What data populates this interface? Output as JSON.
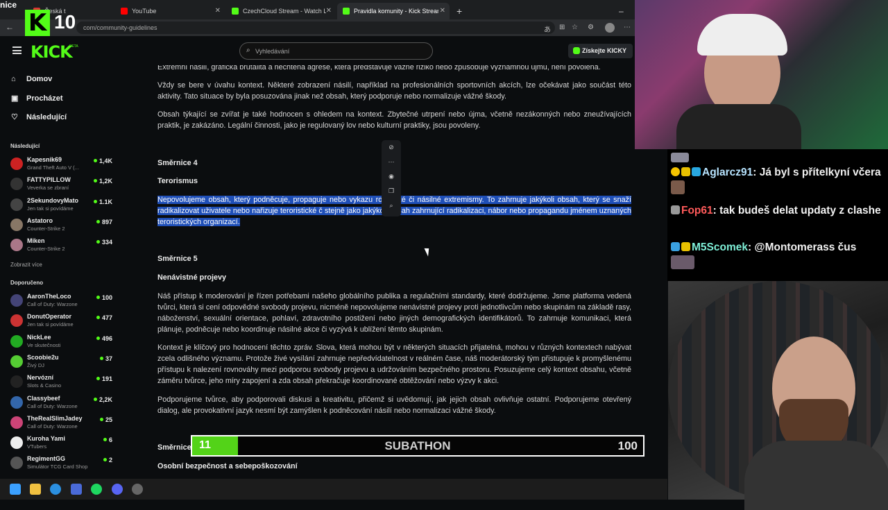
{
  "browser": {
    "tabs": [
      {
        "label": "Česká t",
        "color": "#d33"
      },
      {
        "label": "YouTube",
        "color": "#f00"
      },
      {
        "label": "CzechCloud Stream - Watch Live o",
        "color": "#53fc18"
      },
      {
        "label": "Pravidla komunity - Kick Streamin",
        "color": "#53fc18"
      }
    ],
    "url": "com/community-guidelines",
    "overlay_text": "nice"
  },
  "kick": {
    "logo": "KICK",
    "beta": "BETA",
    "search_placeholder": "Vyhledávání",
    "get_kicky": "Získejte KICKY",
    "counter": "10"
  },
  "sidebar": {
    "nav": [
      {
        "label": "Domov",
        "icon": "home-icon"
      },
      {
        "label": "Procházet",
        "icon": "browse-icon"
      },
      {
        "label": "Následující",
        "icon": "heart-icon"
      }
    ],
    "following_title": "Následující",
    "following": [
      {
        "name": "Kapesnik69",
        "game": "Grand Theft Auto V (...",
        "viewers": "1,4K",
        "color": "#c22"
      },
      {
        "name": "FATTYPILLOW",
        "game": "Veverka se zbraní",
        "viewers": "1,2K",
        "color": "#333"
      },
      {
        "name": "2SekundovyMato",
        "game": "Jen tak si povídáme",
        "viewers": "1.1K",
        "color": "#444"
      },
      {
        "name": "Astatoro",
        "game": "Counter-Strike 2",
        "viewers": "897",
        "color": "#876"
      },
      {
        "name": "Miken",
        "game": "Counter-Strike 2",
        "viewers": "334",
        "color": "#a78"
      }
    ],
    "show_more": "Zobrazit více",
    "recommended_title": "Doporučeno",
    "recommended": [
      {
        "name": "AaronTheLoco",
        "game": "Call of Duty: Warzone",
        "viewers": "100",
        "color": "#447"
      },
      {
        "name": "DonutOperator",
        "game": "Jen tak si povídáme",
        "viewers": "477",
        "color": "#c33"
      },
      {
        "name": "NickLee",
        "game": "Ve skutečnosti",
        "viewers": "496",
        "color": "#2a2"
      },
      {
        "name": "Scoobie2u",
        "game": "Živý DJ",
        "viewers": "37",
        "color": "#5c3"
      },
      {
        "name": "Nervózní",
        "game": "Slots & Casino",
        "viewers": "191",
        "color": "#222"
      },
      {
        "name": "Classybeef",
        "game": "Call of Duty: Warzone",
        "viewers": "2,2K",
        "color": "#36a"
      },
      {
        "name": "TheRealSlimJadey",
        "game": "Call of Duty: Warzone",
        "viewers": "25",
        "color": "#c47"
      },
      {
        "name": "Kuroha Yami",
        "game": "VTubers",
        "viewers": "6",
        "color": "#eee"
      },
      {
        "name": "RegimentGG",
        "game": "Simulátor TCG Card Shop",
        "viewers": "2",
        "color": "#555"
      }
    ]
  },
  "content": {
    "p1": "Extrémní násilí, grafická brutalita a nechtěná agrese, která představuje vážné riziko nebo způsobuje významnou újmu, není povolena.",
    "p2": "Vždy se bere v úvahu kontext. Některé zobrazení násilí, například na profesionálních sportovních akcích, lze očekávat jako součást této aktivity. Tato situace by byla posuzována jinak než obsah, který podporuje nebo normalizuje vážné škody.",
    "p3": "Obsah týkající se zvířat je také hodnocen s ohledem na kontext. Zbytečné utrpení nebo újma, včetně nezákonných nebo zneužívajících praktik, je zakázáno. Legální činnosti, jako je regulovaný lov nebo kulturní praktiky, jsou povoleny.",
    "g4": "Směrnice 4",
    "g4_title": "Terorismus",
    "p4": "Nepovolujeme obsah, který podněcuje, propaguje nebo vykazu  roristické či násilné extremismy. To zahrnuje jakýkoli obsah, který se snaží radikalizovat uživatele nebo nařizuje teroristické č  stejně jako jakýkoli obsah zahrnující radikalizaci, nábor nebo propagandu jménem uznaných teroristických organizací.",
    "g5": "Směrnice 5",
    "g5_title": "Nenávistné projevy",
    "p5": "Náš přístup k moderování je řízen potřebami našeho globálního publika a regulačními standardy, které dodržujeme. Jsme platforma vedená tvůrci, která si cení odpovědné svobody projevu, nicméně nepovolujeme nenávistné projevy proti jednotlivcům nebo skupinám na základě rasy, náboženství, sexuální orientace, pohlaví, zdravotního postižení nebo jiných demografických identifikátorů. To zahrnuje komunikaci, která plánuje, podněcuje nebo koordinuje násilné akce či vyzývá k ublížení těmto skupinám.",
    "p6": "Kontext je klíčový pro hodnocení těchto zpráv. Slova, která mohou být v některých situacích přijatelná, mohou v různých kontextech nabývat zcela odlišného významu. Protože živé vysílání zahrnuje nepředvídatelnost v reálném čase, náš moderátorský tým přistupuje k promyšlenému přístupu k nalezení rovnováhy mezi podporou svobody projevu a udržováním bezpečného prostoru. Posuzujeme celý kontext obsahu, včetně záměru tvůrce, jeho míry zapojení a zda obsah překračuje koordinované obtěžování nebo výzvy k akci.",
    "p7": "Podporujeme tvůrce, aby podporovali diskusi a kreativitu, přičemž si uvědomují, jak jejich obsah ovlivňuje ostatní. Podporujeme otevřený dialog, ale provokativní jazyk nesmí být zamýšlen k podněcování násilí nebo normalizaci vážné škody.",
    "g6": "Směrnice",
    "g6_title": "Osobní bezpečnost a sebepoškozování"
  },
  "subathon": {
    "current": "11",
    "label": "SUBATHON",
    "max": "100",
    "progress_fraction": 0.11
  },
  "chat": [
    {
      "user": "Aglarcz91",
      "user_color": "#b7e4ff",
      "text": "Já byl s přítelkyní včera"
    },
    {
      "user": "Fop61",
      "user_color": "#ff5a5a",
      "text": "tak budeš delat updaty z clashe"
    },
    {
      "user": "M5Scomek",
      "user_color": "#7ff0d8",
      "text": "@Montomerass čus"
    }
  ]
}
